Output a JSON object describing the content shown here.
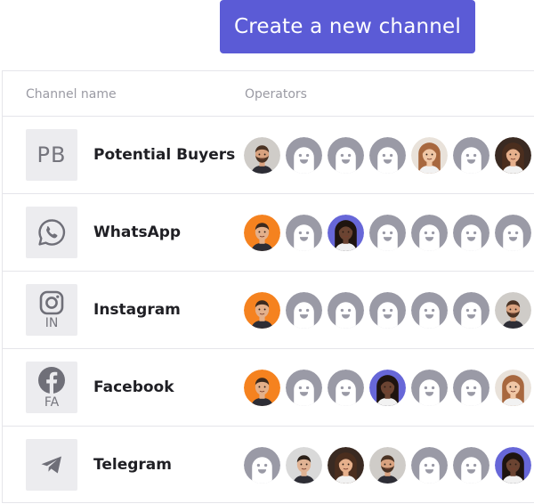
{
  "toolbar": {
    "create_label": "Create a new channel"
  },
  "table": {
    "col_name": "Channel name",
    "col_operators": "Operators"
  },
  "colors": {
    "accent": "#5b5bd6",
    "bot_bg": "#9a9aa6",
    "orange": "#f5821f",
    "purple": "#6767d8"
  },
  "channels": [
    {
      "name": "Potential Buyers",
      "tile_initials": "PB",
      "icon": "initials",
      "operators": [
        "man-beard-gray",
        "bot",
        "bot",
        "bot",
        "woman-light",
        "bot",
        "woman-dark-hair"
      ]
    },
    {
      "name": "WhatsApp",
      "icon": "whatsapp-icon",
      "operators": [
        "man-orange",
        "bot",
        "woman-purple",
        "bot",
        "bot",
        "bot",
        "bot"
      ]
    },
    {
      "name": "Instagram",
      "icon": "instagram-icon",
      "tile_sub": "IN",
      "operators": [
        "man-orange",
        "bot",
        "bot",
        "bot",
        "bot",
        "bot",
        "man-beard-gray"
      ]
    },
    {
      "name": "Facebook",
      "icon": "facebook-icon",
      "tile_sub": "FA",
      "operators": [
        "man-orange",
        "bot",
        "bot",
        "woman-purple",
        "bot",
        "bot",
        "woman-light"
      ]
    },
    {
      "name": "Telegram",
      "icon": "telegram-icon",
      "operators": [
        "bot",
        "man-dark",
        "woman-dark-hair",
        "man-beard-gray",
        "bot",
        "bot",
        "woman-purple"
      ]
    }
  ]
}
